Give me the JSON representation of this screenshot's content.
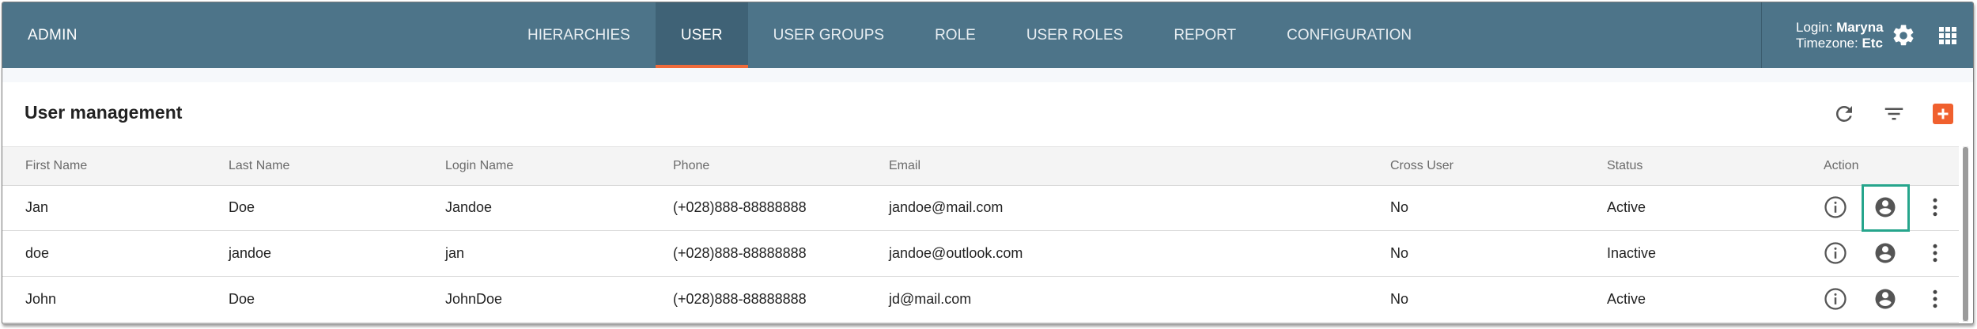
{
  "app": {
    "brand": "ADMIN"
  },
  "nav": {
    "tabs": [
      {
        "label": "HIERARCHIES"
      },
      {
        "label": "USER"
      },
      {
        "label": "USER GROUPS"
      },
      {
        "label": "ROLE"
      },
      {
        "label": "USER ROLES"
      },
      {
        "label": "REPORT"
      },
      {
        "label": "CONFIGURATION"
      }
    ],
    "active": "USER"
  },
  "user": {
    "login_label": "Login:",
    "login_value": "Maryna",
    "timezone_label": "Timezone:",
    "timezone_value": "Etc"
  },
  "page": {
    "title": "User management"
  },
  "toolbar": {
    "icons": [
      "refresh-icon",
      "filter-icon",
      "add-icon"
    ]
  },
  "table": {
    "columns": [
      "First Name",
      "Last Name",
      "Login Name",
      "Phone",
      "Email",
      "Cross User",
      "Status",
      "Action"
    ],
    "rows": [
      {
        "first": "Jan",
        "last": "Doe",
        "login": "Jandoe",
        "phone": "(+028)888-88888888",
        "email": "jandoe@mail.com",
        "cross": "No",
        "status": "Active"
      },
      {
        "first": "doe",
        "last": "jandoe",
        "login": "jan",
        "phone": "(+028)888-88888888",
        "email": "jandoe@outlook.com",
        "cross": "No",
        "status": "Inactive"
      },
      {
        "first": "John",
        "last": "Doe",
        "login": "JohnDoe",
        "phone": "(+028)888-88888888",
        "email": "jd@mail.com",
        "cross": "No",
        "status": "Active"
      }
    ]
  },
  "colors": {
    "topbar": "#4d7489",
    "active_tab": "#3f6276",
    "accent": "#ef6a3a",
    "highlight": "#26a58c"
  }
}
